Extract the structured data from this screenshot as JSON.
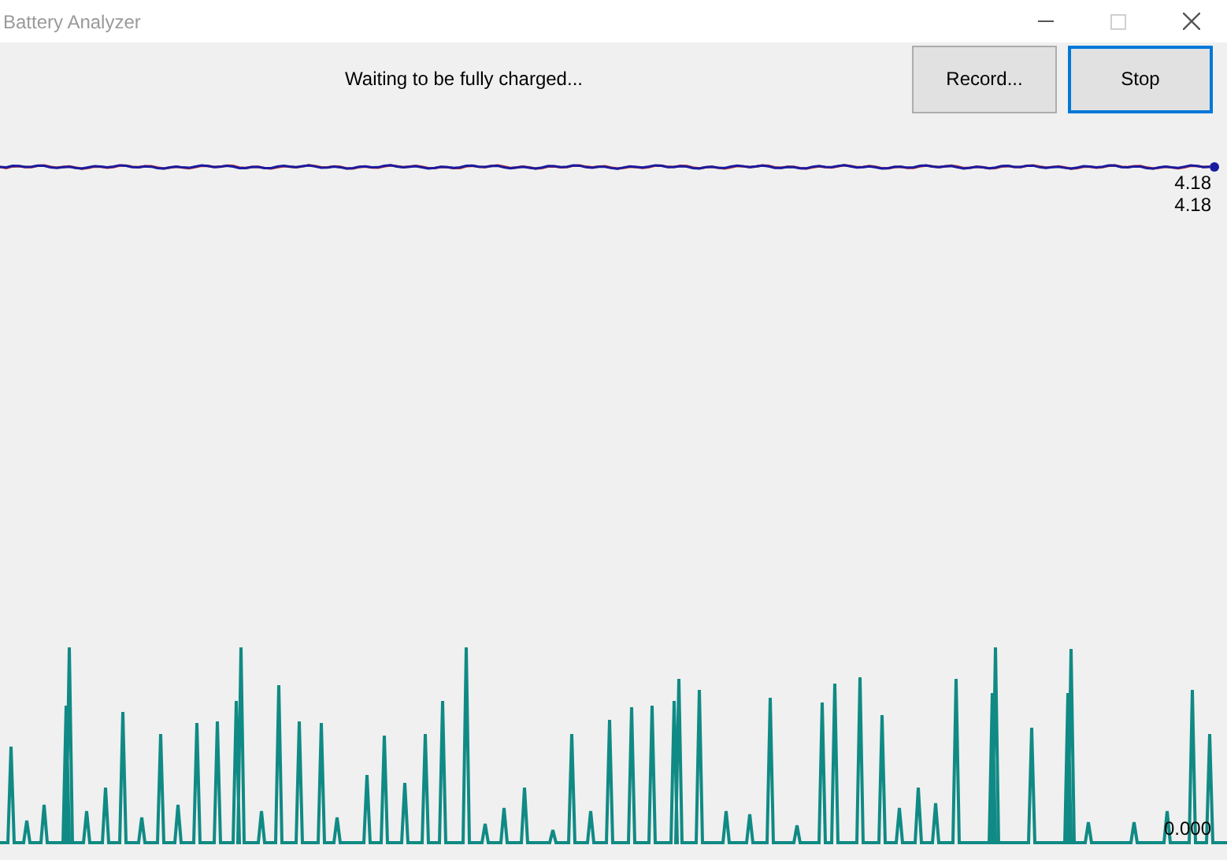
{
  "window": {
    "title": "Battery Analyzer",
    "maximize_disabled": true
  },
  "status_text": "Waiting to be fully charged...",
  "buttons": [
    {
      "label": "Record...",
      "focused": false
    },
    {
      "label": "Stop",
      "focused": true
    }
  ],
  "voltage_readings": [
    "4.18",
    "4.18"
  ],
  "current_reading": "0.000"
}
